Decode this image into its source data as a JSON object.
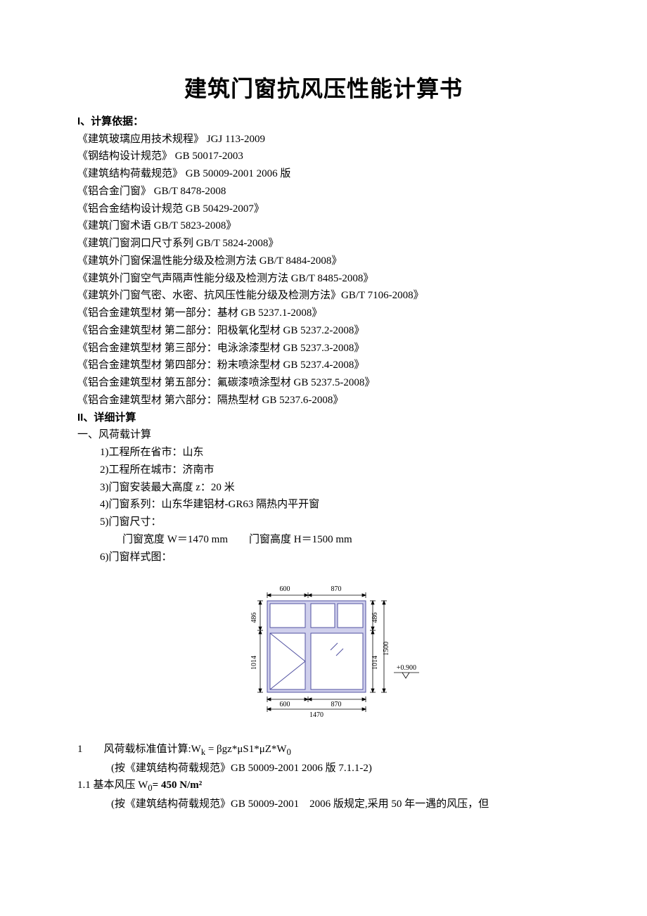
{
  "title": "建筑门窗抗风压性能计算书",
  "section1": {
    "heading": "I、计算依据：",
    "refs": [
      "《建筑玻璃应用技术规程》 JGJ 113-2009",
      "《钢结构设计规范》 GB 50017-2003",
      "《建筑结构荷载规范》 GB 50009-2001 2006 版",
      "《铝合金门窗》 GB/T 8478-2008",
      "《铝合金结构设计规范 GB 50429-2007》",
      "《建筑门窗术语 GB/T 5823-2008》",
      "《建筑门窗洞口尺寸系列 GB/T 5824-2008》",
      "《建筑外门窗保温性能分级及检测方法 GB/T 8484-2008》",
      "《建筑外门窗空气声隔声性能分级及检测方法 GB/T 8485-2008》",
      "《建筑外门窗气密、水密、抗风压性能分级及检测方法》GB/T 7106-2008》",
      "《铝合金建筑型材 第一部分：基材 GB 5237.1-2008》",
      "《铝合金建筑型材 第二部分：阳极氧化型材 GB 5237.2-2008》",
      "《铝合金建筑型材 第三部分：电泳涂漆型材 GB 5237.3-2008》",
      "《铝合金建筑型材 第四部分：粉末喷涂型材 GB 5237.4-2008》",
      "《铝合金建筑型材 第五部分：氟碳漆喷涂型材 GB 5237.5-2008》",
      "《铝合金建筑型材 第六部分：隔热型材 GB 5237.6-2008》"
    ]
  },
  "section2": {
    "heading": "II、详细计算",
    "sub_heading": "一、风荷载计算",
    "items": {
      "i1": "1)工程所在省市：山东",
      "i2": "2)工程所在城市：济南市",
      "i3": "3)门窗安装最大高度 z：20 米",
      "i4": "4)门窗系列：山东华建铝材-GR63 隔热内平开窗",
      "i5": "5)门窗尺寸：",
      "i5_detail": "门窗宽度 W＝1470 mm　　门窗高度 H＝1500 mm",
      "i6": "6)门窗样式图："
    }
  },
  "diagram": {
    "top_left": "600",
    "top_right": "870",
    "left_top": "486",
    "left_bottom": "1014",
    "right_top": "486",
    "right_bottom": "1014",
    "right_total": "1500",
    "bottom_left": "600",
    "bottom_right": "870",
    "bottom_total": "1470",
    "level": "+0.900"
  },
  "calc": {
    "line1_label": "1　　风荷载标准值计算:W",
    "line1_sub": "k",
    "line1_rest": " = βgz*μS1*μZ*W",
    "line1_sub2": "0",
    "line1_note": "(按《建筑结构荷载规范》GB 50009-2001 2006 版 7.1.1-2)",
    "line2_label": "1.1 基本风压 W",
    "line2_sub": "0",
    "line2_rest": "= 450 N/m²",
    "line2_note": "(按《建筑结构荷载规范》GB 50009-2001　2006 版规定,采用 50 年一遇的风压，但"
  }
}
